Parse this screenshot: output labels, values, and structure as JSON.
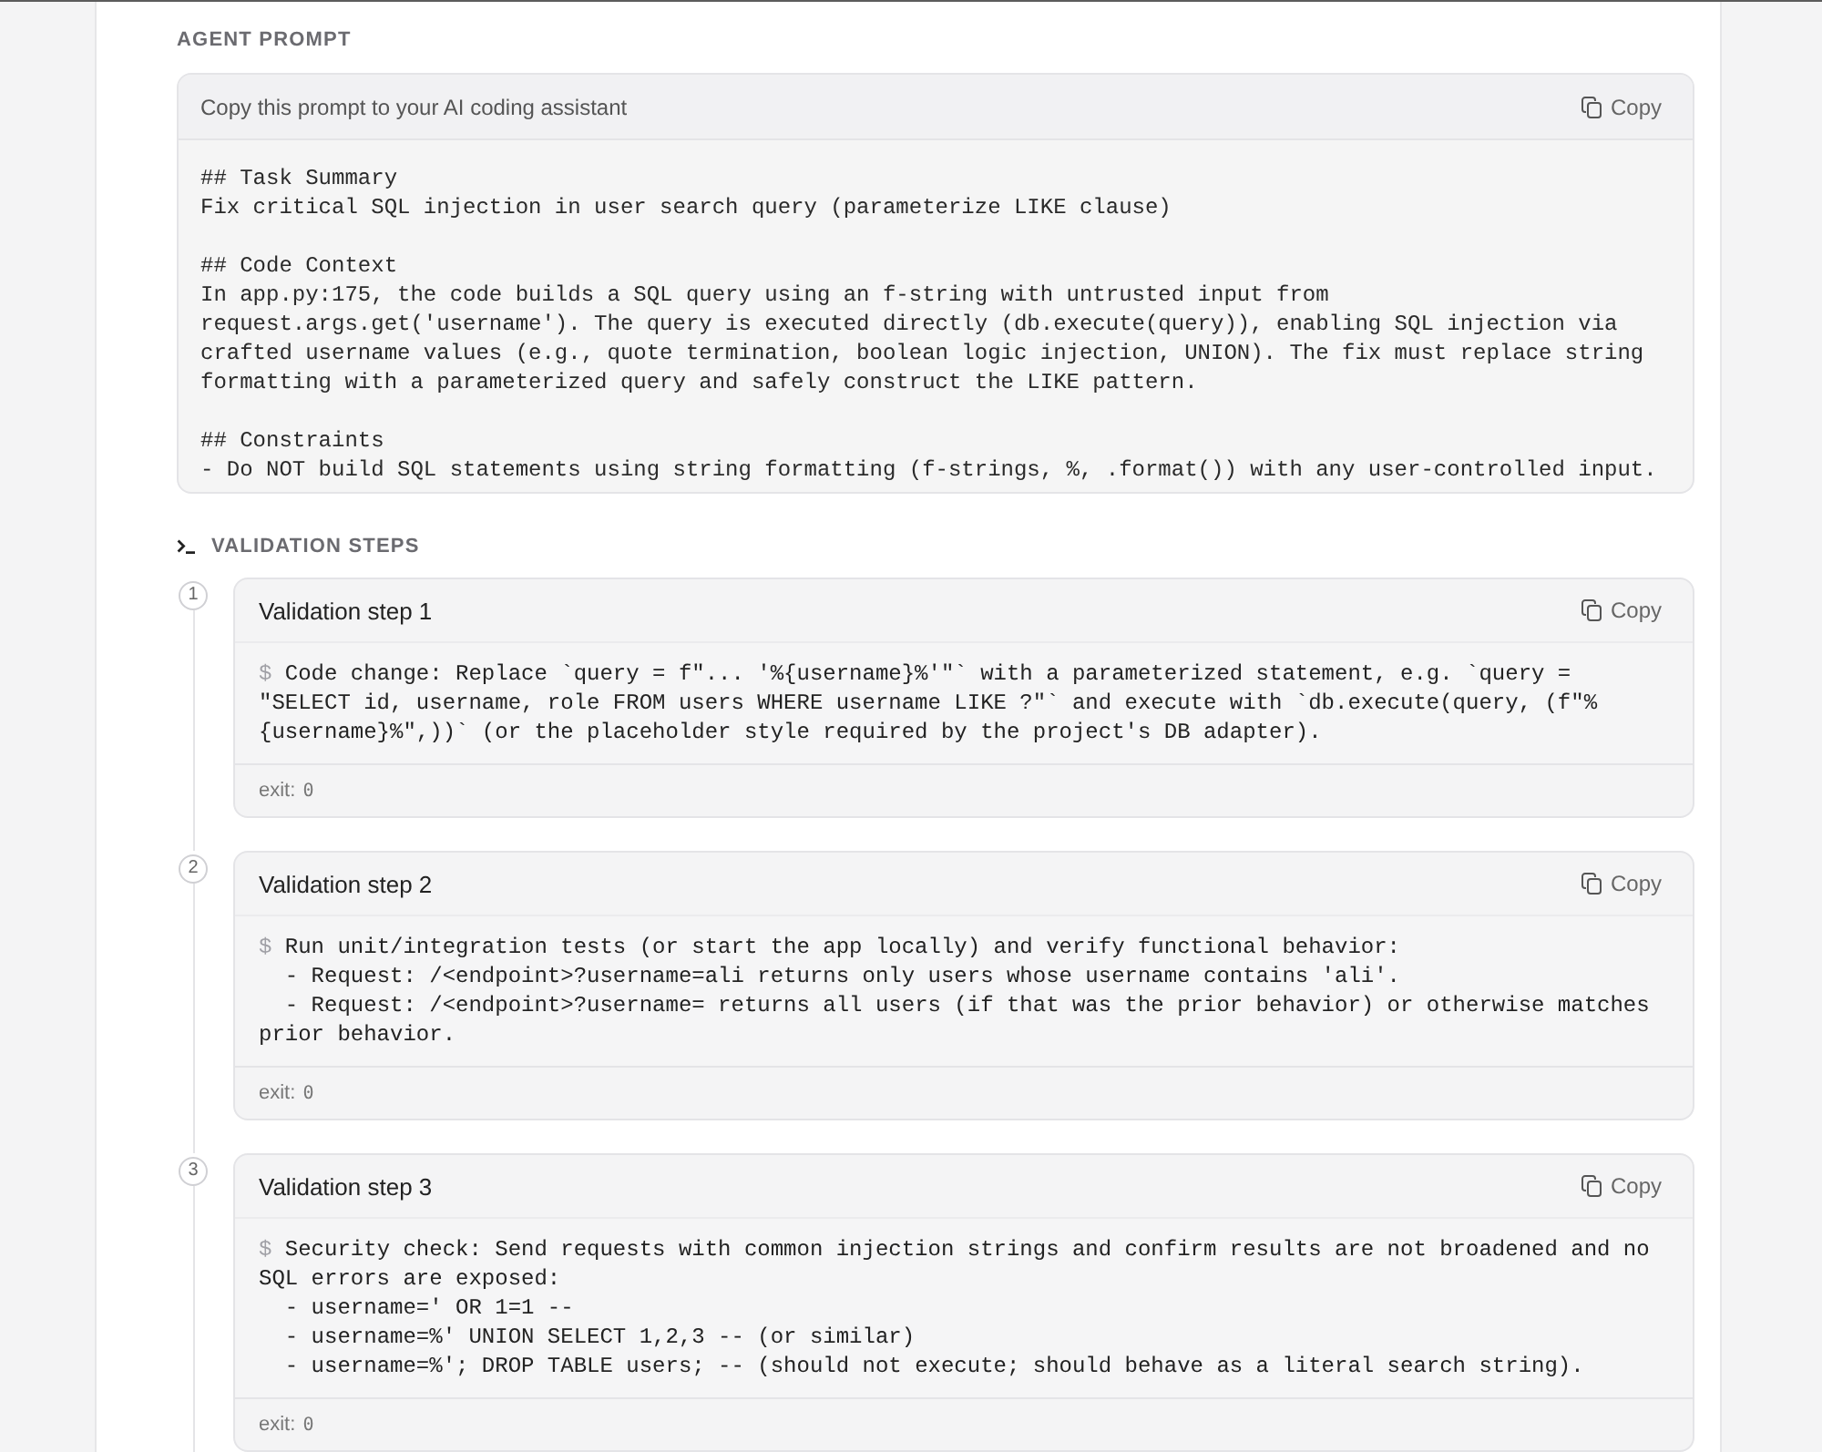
{
  "prompt_section": {
    "heading": "AGENT PROMPT",
    "hint": "Copy this prompt to your AI coding assistant",
    "copy_label": "Copy",
    "text": "## Task Summary\nFix critical SQL injection in user search query (parameterize LIKE clause)\n\n## Code Context\nIn app.py:175, the code builds a SQL query using an f-string with untrusted input from request.args.get('username'). The query is executed directly (db.execute(query)), enabling SQL injection via crafted username values (e.g., quote termination, boolean logic injection, UNION). The fix must replace string formatting with a parameterized query and safely construct the LIKE pattern.\n\n## Constraints\n- Do NOT build SQL statements using string formatting (f-strings, %, .format()) with any user-controlled input."
  },
  "validation": {
    "heading": "VALIDATION STEPS",
    "steps": [
      {
        "number": "1",
        "title": "Validation step 1",
        "copy_label": "Copy",
        "prompt_symbol": "$",
        "command": "Code change: Replace `query = f\"... '%{username}%'\"` with a parameterized statement, e.g. `query = \"SELECT id, username, role FROM users WHERE username LIKE ?\"` and execute with `db.execute(query, (f\"%{username}%\",))` (or the placeholder style required by the project's DB adapter).",
        "exit_label": "exit:",
        "exit_code": "0"
      },
      {
        "number": "2",
        "title": "Validation step 2",
        "copy_label": "Copy",
        "prompt_symbol": "$",
        "command": "Run unit/integration tests (or start the app locally) and verify functional behavior:\n  - Request: /<endpoint>?username=ali returns only users whose username contains 'ali'.\n  - Request: /<endpoint>?username= returns all users (if that was the prior behavior) or otherwise matches prior behavior.",
        "exit_label": "exit:",
        "exit_code": "0"
      },
      {
        "number": "3",
        "title": "Validation step 3",
        "copy_label": "Copy",
        "prompt_symbol": "$",
        "command": "Security check: Send requests with common injection strings and confirm results are not broadened and no SQL errors are exposed:\n  - username=' OR 1=1 --\n  - username=%' UNION SELECT 1,2,3 -- (or similar)\n  - username=%'; DROP TABLE users; -- (should not execute; should behave as a literal search string).",
        "exit_label": "exit:",
        "exit_code": "0"
      }
    ]
  }
}
